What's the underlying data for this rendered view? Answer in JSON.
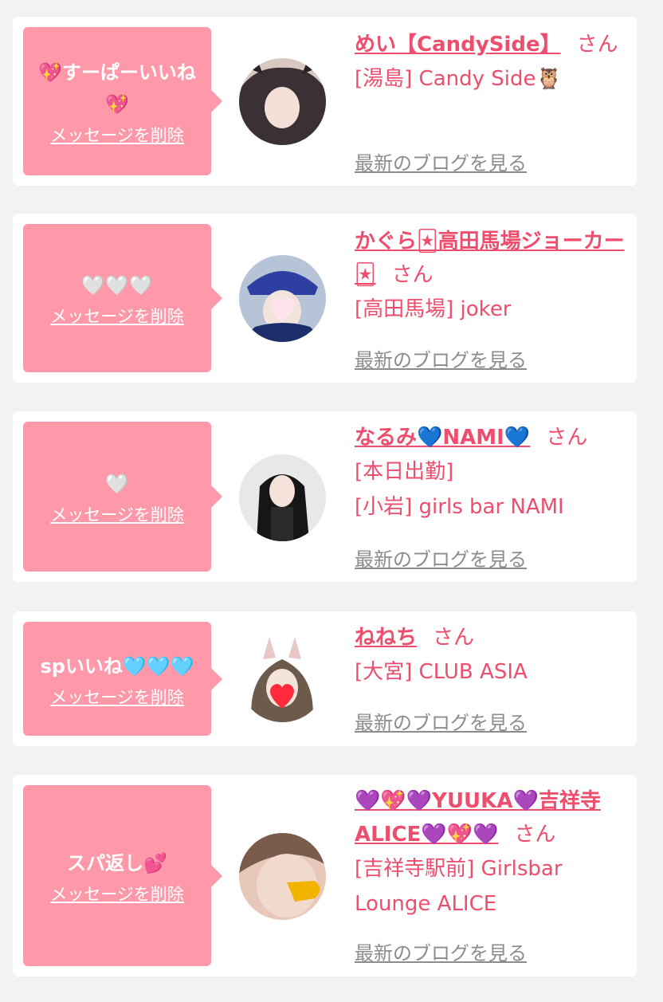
{
  "items": [
    {
      "message": "💖すーぱーいいね💖",
      "delete_label": "メッセージを削除",
      "name": "めい【CandySide】",
      "honorific": "さん",
      "details": [
        "[湯島] Candy Side🦉"
      ],
      "blog_label": "最新のブログを見る",
      "avatar_colors": [
        "#d9c7c1",
        "#3b3033"
      ]
    },
    {
      "message": "🤍🤍🤍",
      "delete_label": "メッセージを削除",
      "name": "かぐら🃏高田馬場ジョーカー🃏",
      "honorific": "さん",
      "details": [
        "[高田馬場] joker"
      ],
      "blog_label": "最新のブログを見る",
      "avatar_colors": [
        "#b7c3d6",
        "#2d3fa0"
      ]
    },
    {
      "message": "🤍",
      "delete_label": "メッセージを削除",
      "name": "なるみ💙NAMI💙",
      "honorific": "さん",
      "details": [
        "[本日出勤]",
        "[小岩] girls bar NAMI"
      ],
      "blog_label": "最新のブログを見る",
      "avatar_colors": [
        "#e8e8e8",
        "#161616"
      ]
    },
    {
      "message": "spいいね🩵🩵🩵",
      "delete_label": "メッセージを削除",
      "name": "ねねち",
      "honorific": "さん",
      "details": [
        "[大宮] CLUB ASIA"
      ],
      "blog_label": "最新のブログを見る",
      "avatar_colors": [
        "#f0ece8",
        "#6c5a4a"
      ]
    },
    {
      "message": "スパ返し💕",
      "delete_label": "メッセージを削除",
      "name": "💜💖💜YUUKA💜吉祥寺ALICE💜💖💜",
      "honorific": "さん",
      "details": [
        "[吉祥寺駅前] Girlsbar Lounge ALICE"
      ],
      "blog_label": "最新のブログを見る",
      "avatar_colors": [
        "#e7c7b8",
        "#7b5b4b"
      ]
    }
  ]
}
